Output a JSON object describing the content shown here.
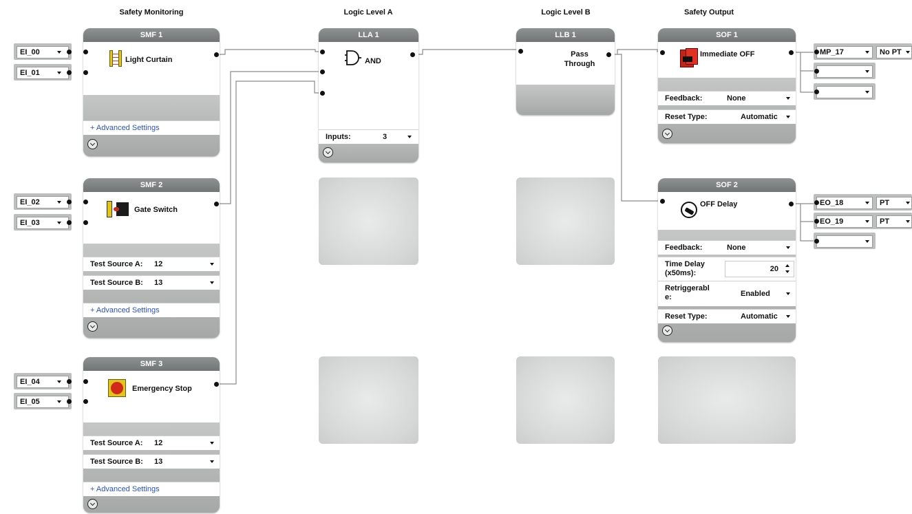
{
  "columns": {
    "safety_monitoring": "Safety Monitoring",
    "logic_a": "Logic Level A",
    "logic_b": "Logic Level B",
    "safety_output": "Safety Output"
  },
  "smf1": {
    "title": "SMF 1",
    "label": "Light Curtain",
    "icon": "light-curtain-icon",
    "advanced": "+ Advanced Settings",
    "inputs": [
      "EI_00",
      "EI_01"
    ]
  },
  "smf2": {
    "title": "SMF 2",
    "label": "Gate Switch",
    "icon": "gate-switch-icon",
    "test_a_label": "Test Source A:",
    "test_a_value": "12",
    "test_b_label": "Test Source B:",
    "test_b_value": "13",
    "advanced": "+ Advanced Settings",
    "inputs": [
      "EI_02",
      "EI_03"
    ]
  },
  "smf3": {
    "title": "SMF 3",
    "label": "Emergency Stop",
    "icon": "emergency-stop-icon",
    "test_a_label": "Test Source A:",
    "test_a_value": "12",
    "test_b_label": "Test Source B:",
    "test_b_value": "13",
    "advanced": "+ Advanced Settings",
    "inputs": [
      "EI_04",
      "EI_05"
    ]
  },
  "lla1": {
    "title": "LLA 1",
    "label": "AND",
    "icon": "and-gate-icon",
    "inputs_label": "Inputs:",
    "inputs_value": "3"
  },
  "llb1": {
    "title": "LLB 1",
    "label_line1": "Pass",
    "label_line2": "Through"
  },
  "sof1": {
    "title": "SOF 1",
    "label": "Immediate OFF",
    "icon": "immediate-off-icon",
    "feedback_label": "Feedback:",
    "feedback_value": "None",
    "reset_label": "Reset Type:",
    "reset_value": "Automatic",
    "outputs": [
      {
        "name": "MP_17",
        "pt": "No PT"
      },
      {
        "name": ""
      },
      {
        "name": ""
      }
    ]
  },
  "sof2": {
    "title": "SOF 2",
    "label": "OFF Delay",
    "icon": "off-delay-icon",
    "feedback_label": "Feedback:",
    "feedback_value": "None",
    "delay_label_line1": "Time Delay",
    "delay_label_line2": "(x50ms):",
    "delay_value": "20",
    "retrig_label_line1": "Retriggerabl",
    "retrig_label_line2": "e:",
    "retrig_value": "Enabled",
    "reset_label": "Reset Type:",
    "reset_value": "Automatic",
    "outputs": [
      {
        "name": "EO_18",
        "pt": "PT"
      },
      {
        "name": "EO_19",
        "pt": "PT"
      },
      {
        "name": ""
      }
    ]
  },
  "colors": {
    "header": "#7f8282",
    "footer": "#b5b7b7",
    "link": "#2a4fd0",
    "wire": "#8a8a8a"
  }
}
